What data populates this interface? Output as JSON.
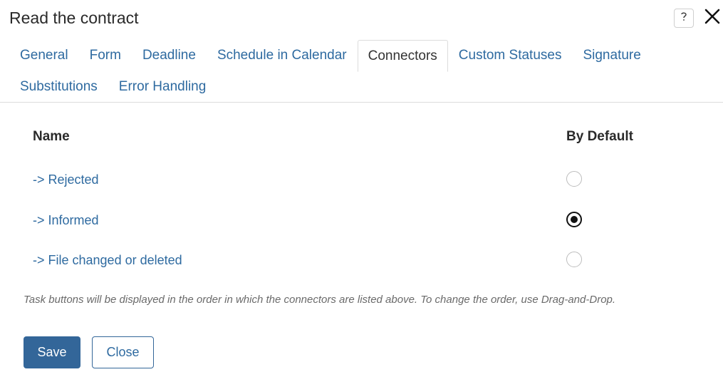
{
  "dialog": {
    "title": "Read the contract"
  },
  "tabs": {
    "row1": [
      {
        "label": "General",
        "active": false
      },
      {
        "label": "Form",
        "active": false
      },
      {
        "label": "Deadline",
        "active": false
      },
      {
        "label": "Schedule in Calendar",
        "active": false
      },
      {
        "label": "Connectors",
        "active": true
      },
      {
        "label": "Custom Statuses",
        "active": false
      },
      {
        "label": "Signature",
        "active": false
      }
    ],
    "row2": [
      {
        "label": "Substitutions",
        "active": false
      },
      {
        "label": "Error Handling",
        "active": false
      }
    ]
  },
  "table": {
    "headers": {
      "name": "Name",
      "default": "By Default"
    },
    "rows": [
      {
        "label": "-> Rejected",
        "selected": false
      },
      {
        "label": "-> Informed",
        "selected": true
      },
      {
        "label": "-> File changed or deleted",
        "selected": false
      }
    ]
  },
  "hint": "Task buttons will be displayed in the order in which the connectors are listed above. To change the order, use Drag-and-Drop.",
  "buttons": {
    "save": "Save",
    "close": "Close"
  },
  "icons": {
    "help": "help-icon",
    "close": "close-icon"
  },
  "colors": {
    "link": "#2e6aa0",
    "primary": "#336699"
  }
}
